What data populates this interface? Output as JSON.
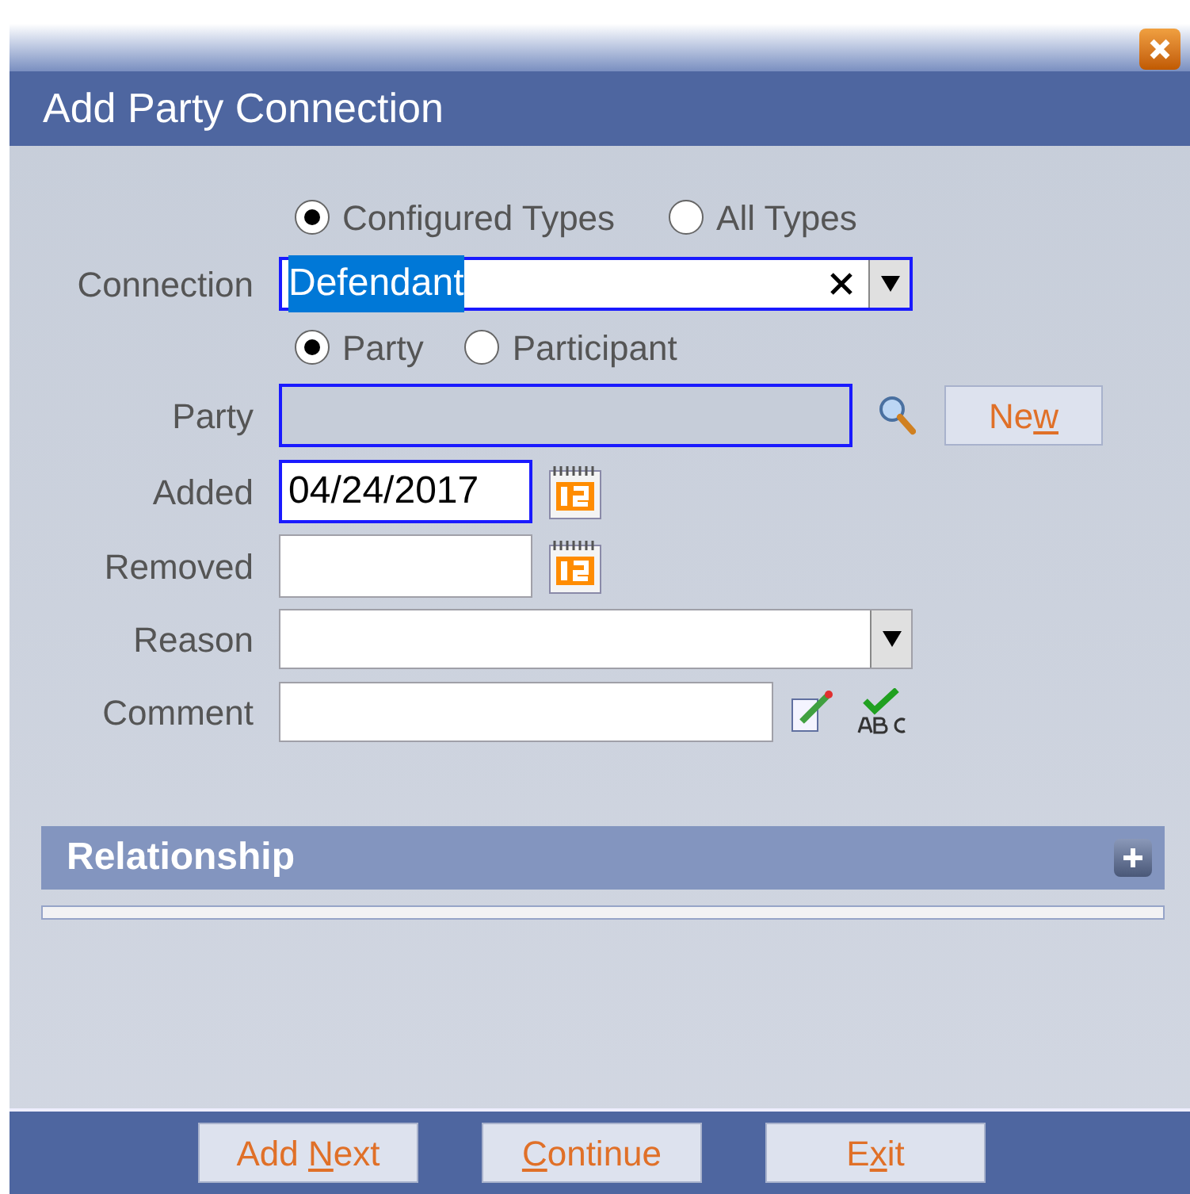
{
  "dialog": {
    "title": "Add Party Connection"
  },
  "type_options": [
    {
      "label": "Configured Types",
      "selected": true
    },
    {
      "label": "All Types",
      "selected": false
    }
  ],
  "connection": {
    "label": "Connection",
    "value": "Defendant",
    "value_selected": true,
    "highlighted": true
  },
  "target_options": [
    {
      "label": "Party",
      "selected": true
    },
    {
      "label": "Participant",
      "selected": false
    }
  ],
  "party": {
    "label": "Party",
    "disabled": true,
    "highlighted": true
  },
  "new_button": {
    "label_before": "Ne",
    "access_key": "w"
  },
  "added": {
    "label": "Added",
    "value": "04/24/2017",
    "highlighted": true
  },
  "removed": {
    "label": "Removed",
    "highlighted": false
  },
  "reason": {
    "label": "Reason",
    "highlighted": false
  },
  "comment": {
    "label": "Comment",
    "highlighted": false
  },
  "relationship": {
    "title": "Relationship",
    "expanded": false
  },
  "buttons": [
    {
      "label_before": "Add ",
      "access_key": "N",
      "label_after": "ext"
    },
    {
      "access_key": "C",
      "label_after": "ontinue"
    },
    {
      "label_before": "E",
      "access_key": "x",
      "label_after": "it"
    }
  ]
}
